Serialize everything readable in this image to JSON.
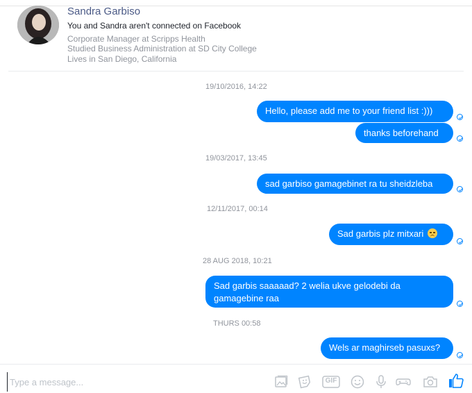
{
  "profile": {
    "name": "Sandra Garbiso",
    "connection": "You and Sandra aren't connected on Facebook",
    "details": [
      "Corporate Manager at Scripps Health",
      "Studied Business Administration at SD City College",
      "Lives in San Diego, California"
    ]
  },
  "thread": {
    "timestamps": [
      "19/10/2016, 14:22",
      "19/03/2017, 13:45",
      "12/11/2017, 00:14",
      "28 AUG 2018, 10:21",
      "THURS 00:58"
    ],
    "messages": [
      "Hello, please add me to your friend list :)))",
      "thanks beforehand",
      "sad garbiso gamagebinet ra tu sheidzleba",
      "Sad garbis plz mitxari",
      "Sad garbis saaaaad? 2 welia ukve gelodebi da gamagebine raa",
      "Wels ar maghirseb pasuxs?"
    ]
  },
  "composer": {
    "placeholder": "Type a message...",
    "gif_label": "GIF"
  },
  "colors": {
    "accent": "#0084ff",
    "timestamp": "#90949c"
  }
}
